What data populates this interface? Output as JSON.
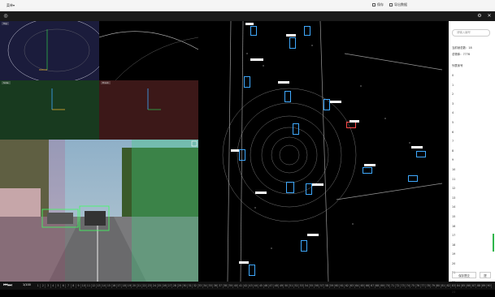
{
  "topbar": {
    "menu_label": "菜单▾",
    "save_label": "保存",
    "export_label": "导出数据"
  },
  "views": {
    "top_label": "Top",
    "side_label": "Side",
    "front_label": "Front"
  },
  "right_panel": {
    "search_placeholder": "请输入编号",
    "frame_count_label": "当前帧总数：",
    "frame_count": "18",
    "total_label": "总物体：",
    "total_value": "7778",
    "list_header": "列表序号",
    "list_items": [
      "0",
      "1",
      "2",
      "3",
      "4",
      "5",
      "6",
      "7",
      "8",
      "9",
      "10",
      "11",
      "12",
      "13",
      "14",
      "15",
      "16",
      "17",
      "18",
      "19",
      "20",
      "21",
      "22",
      "23"
    ],
    "btn_prev": "保存提交",
    "btn_next": "提"
  },
  "timeline": {
    "position": "1/100",
    "frames": [
      "1",
      "2",
      "3",
      "4",
      "5",
      "6",
      "7",
      "8",
      "9",
      "10",
      "11",
      "12",
      "13",
      "14",
      "15",
      "16",
      "17",
      "18",
      "19",
      "20",
      "21",
      "22",
      "23",
      "24",
      "25",
      "26",
      "27",
      "28",
      "29",
      "30",
      "31",
      "32",
      "33",
      "34",
      "35",
      "36",
      "37",
      "38",
      "39",
      "40",
      "41",
      "42",
      "43",
      "44",
      "45",
      "46",
      "47",
      "48",
      "49",
      "50",
      "51",
      "52",
      "53",
      "54",
      "55",
      "56",
      "57",
      "58",
      "59",
      "60",
      "61",
      "62",
      "63",
      "64",
      "65",
      "66",
      "67",
      "68",
      "69",
      "70",
      "71",
      "72",
      "73",
      "74",
      "75",
      "76",
      "77",
      "78",
      "79",
      "80",
      "81",
      "82",
      "83",
      "84",
      "85",
      "86",
      "87",
      "88",
      "89",
      "90"
    ]
  },
  "colors": {
    "accent": "#3fa9ff",
    "selected": "#2db54a",
    "topbar_bg": "#f5f5f5"
  }
}
